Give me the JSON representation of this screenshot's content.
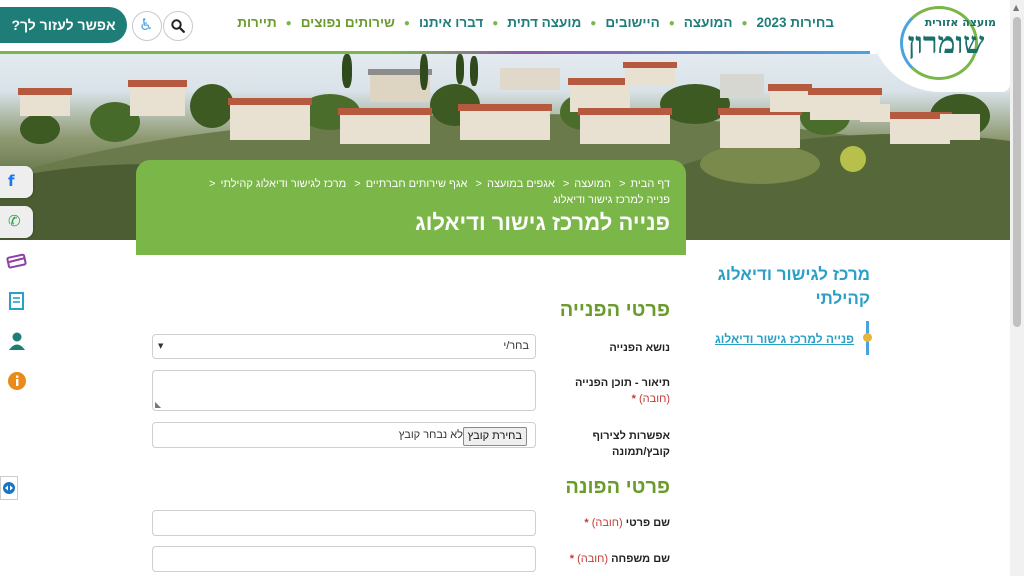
{
  "logo": {
    "small_text": "מועצה אזורית",
    "big_text": "שומרון"
  },
  "nav": {
    "items": [
      {
        "label": "בחירות 2023"
      },
      {
        "label": "המועצה"
      },
      {
        "label": "היישובים"
      },
      {
        "label": "מועצה דתית"
      },
      {
        "label": "דברו איתנו"
      },
      {
        "label": "שירותים נפוצים"
      },
      {
        "label": "תיירות"
      }
    ]
  },
  "header": {
    "help_label": "אפשר לעזור לך?"
  },
  "breadcrumb": {
    "items": [
      {
        "label": "דף הבית"
      },
      {
        "label": "המועצה"
      },
      {
        "label": "אגפים במועצה"
      },
      {
        "label": "אגף שירותים חברתיים"
      },
      {
        "label": "מרכז לגישור ודיאלוג קהילתי"
      },
      {
        "label": "פנייה למרכז גישור ודיאלוג"
      }
    ]
  },
  "page": {
    "title": "פנייה למרכז גישור ודיאלוג"
  },
  "form": {
    "section1_title": "פרטי הפנייה",
    "section2_title": "פרטי הפונה",
    "subject_label": "נושא הפנייה",
    "subject_value": "בחר/י",
    "description_label": "תיאור - תוכן הפנייה",
    "required_text": "(חובה)",
    "required_star": "*",
    "attachment_label": "אפשרות לצירוף קובץ/תמונה",
    "file_button_label": "בחירת קובץ",
    "file_status": "לא נבחר קובץ",
    "first_name_label": "שם פרטי",
    "last_name_label": "שם משפחה"
  },
  "sidebar": {
    "title": "מרכז לגישור ודיאלוג קהילתי",
    "link_label": "פנייה למרכז גישור ודיאלוג"
  },
  "social": {
    "facebook_glyph": "f",
    "whatsapp_glyph": "✆"
  },
  "colors": {
    "brand_green": "#7ab648",
    "brand_teal": "#1f7d77",
    "link_blue": "#2aa0c7",
    "required_red": "#c23b32"
  }
}
